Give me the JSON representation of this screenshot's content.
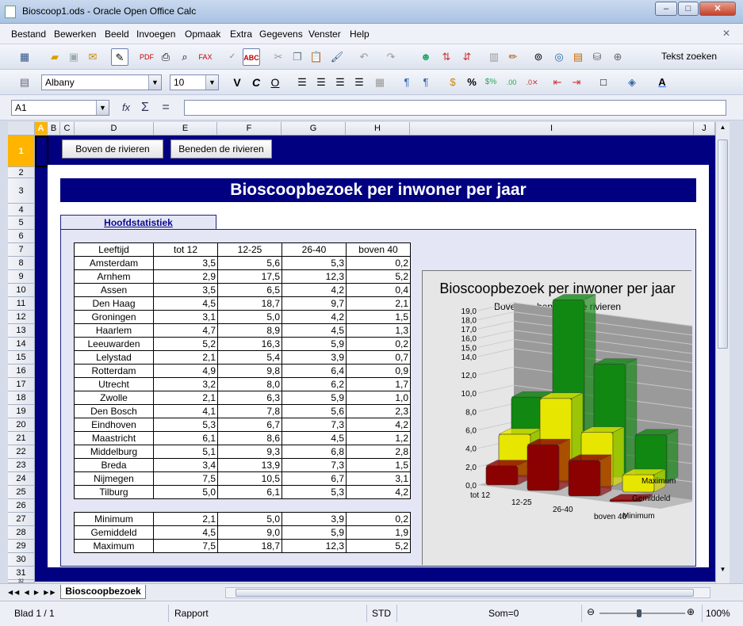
{
  "window": {
    "title": "Bioscoop1.ods - Oracle Open Office Calc",
    "btn_min": "–",
    "btn_max": "□",
    "btn_close": "✕"
  },
  "menu": [
    "Bestand",
    "Bewerken",
    "Beeld",
    "Invoegen",
    "Opmaak",
    "Extra",
    "Gegevens",
    "Venster",
    "Help"
  ],
  "menu_close": "✕",
  "toolbar": {
    "find_label": "Tekst zoeken"
  },
  "format": {
    "font": "Albany",
    "size": "10",
    "bold": "V",
    "italic": "C",
    "underline": "O"
  },
  "formula_bar": {
    "cell_ref": "A1",
    "formula": ""
  },
  "columns": [
    "A",
    "B",
    "C",
    "D",
    "E",
    "F",
    "G",
    "H",
    "I",
    "J"
  ],
  "rows": [
    "1",
    "2",
    "3",
    "4",
    "5",
    "6",
    "7",
    "8",
    "9",
    "10",
    "11",
    "12",
    "13",
    "14",
    "15",
    "16",
    "17",
    "18",
    "19",
    "20",
    "21",
    "22",
    "23",
    "24",
    "25",
    "26",
    "27",
    "28",
    "29",
    "30",
    "31",
    "32"
  ],
  "sheet": {
    "button_boven": "Boven de rivieren",
    "button_beneden": "Beneden de rivieren",
    "banner": "Bioscoopbezoek per inwoner per jaar",
    "section_tab": "Hoofdstatistiek",
    "header": [
      "Leeftijd",
      "tot 12",
      "12-25",
      "26-40",
      "boven 40"
    ],
    "cities": [
      [
        "Amsterdam",
        "3,5",
        "5,6",
        "5,3",
        "0,2"
      ],
      [
        "Arnhem",
        "2,9",
        "17,5",
        "12,3",
        "5,2"
      ],
      [
        "Assen",
        "3,5",
        "6,5",
        "4,2",
        "0,4"
      ],
      [
        "Den Haag",
        "4,5",
        "18,7",
        "9,7",
        "2,1"
      ],
      [
        "Groningen",
        "3,1",
        "5,0",
        "4,2",
        "1,5"
      ],
      [
        "Haarlem",
        "4,7",
        "8,9",
        "4,5",
        "1,3"
      ],
      [
        "Leeuwarden",
        "5,2",
        "16,3",
        "5,9",
        "0,2"
      ],
      [
        "Lelystad",
        "2,1",
        "5,4",
        "3,9",
        "0,7"
      ],
      [
        "Rotterdam",
        "4,9",
        "9,8",
        "6,4",
        "0,9"
      ],
      [
        "Utrecht",
        "3,2",
        "8,0",
        "6,2",
        "1,7"
      ],
      [
        "Zwolle",
        "2,1",
        "6,3",
        "5,9",
        "1,0"
      ],
      [
        "Den Bosch",
        "4,1",
        "7,8",
        "5,6",
        "2,3"
      ],
      [
        "Eindhoven",
        "5,3",
        "6,7",
        "7,3",
        "4,2"
      ],
      [
        "Maastricht",
        "6,1",
        "8,6",
        "4,5",
        "1,2"
      ],
      [
        "Middelburg",
        "5,1",
        "9,3",
        "6,8",
        "2,8"
      ],
      [
        "Breda",
        "3,4",
        "13,9",
        "7,3",
        "1,5"
      ],
      [
        "Nijmegen",
        "7,5",
        "10,5",
        "6,7",
        "3,1"
      ],
      [
        "Tilburg",
        "5,0",
        "6,1",
        "5,3",
        "4,2"
      ]
    ],
    "stats": [
      [
        "Minimum",
        "2,1",
        "5,0",
        "3,9",
        "0,2"
      ],
      [
        "Gemiddeld",
        "4,5",
        "9,0",
        "5,9",
        "1,9"
      ],
      [
        "Maximum",
        "7,5",
        "18,7",
        "12,3",
        "5,2"
      ]
    ]
  },
  "chart_data": {
    "type": "bar",
    "title": "Bioscoopbezoek per inwoner per jaar",
    "subtitle": "Boven en beneden de rivieren",
    "categories": [
      "tot 12",
      "12-25",
      "26-40",
      "boven 40"
    ],
    "series": [
      {
        "name": "Minimum",
        "values": [
          2.1,
          5.0,
          3.9,
          0.2
        ],
        "color": "#8b0000"
      },
      {
        "name": "Gemiddeld",
        "values": [
          4.5,
          9.0,
          5.9,
          1.9
        ],
        "color": "#e6e600"
      },
      {
        "name": "Maximum",
        "values": [
          7.5,
          18.7,
          12.3,
          5.2
        ],
        "color": "#118811"
      }
    ],
    "yticks": [
      "0,0",
      "2,0",
      "4,0",
      "6,0",
      "8,0",
      "10,0",
      "12,0",
      "14,0",
      "15,0",
      "16,0",
      "17,0",
      "18,0",
      "19,0"
    ],
    "ylim": [
      0,
      19
    ]
  },
  "tabs": {
    "active": "Bioscoopbezoek"
  },
  "status": {
    "sheet": "Blad 1 / 1",
    "style": "Rapport",
    "mode": "STD",
    "sum": "Som=0",
    "zoom": "100%"
  }
}
